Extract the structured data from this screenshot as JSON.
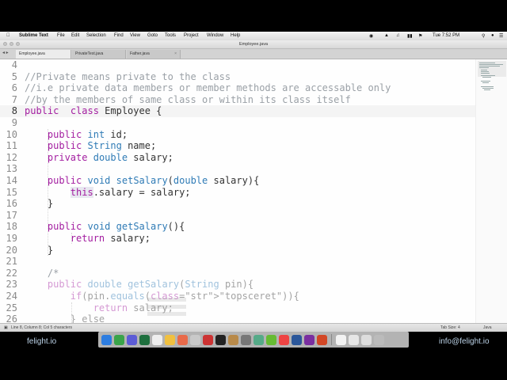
{
  "menubar": {
    "app_name": "Sublime Text",
    "items": [
      "File",
      "Edit",
      "Selection",
      "Find",
      "View",
      "Goto",
      "Tools",
      "Project",
      "Window",
      "Help"
    ],
    "clock": "Tue 7:52 PM"
  },
  "window": {
    "title": "Employee.java"
  },
  "tabs": [
    {
      "label": "Employee.java",
      "active": true
    },
    {
      "label": "PrivateTest.java",
      "active": false
    },
    {
      "label": "Father.java",
      "active": false
    }
  ],
  "editor": {
    "current_line": 8,
    "lines": [
      {
        "n": 4,
        "text": ""
      },
      {
        "n": 5,
        "text": "//Private means private to the class"
      },
      {
        "n": 6,
        "text": "//i.e private data members or member methods are accessable only"
      },
      {
        "n": 7,
        "text": "//by the members of same class or within its class itself"
      },
      {
        "n": 8,
        "text": "public  class Employee {"
      },
      {
        "n": 9,
        "text": ""
      },
      {
        "n": 10,
        "text": "    public int id;"
      },
      {
        "n": 11,
        "text": "    public String name;"
      },
      {
        "n": 12,
        "text": "    private double salary;"
      },
      {
        "n": 13,
        "text": ""
      },
      {
        "n": 14,
        "text": "    public void setSalary(double salary){"
      },
      {
        "n": 15,
        "text": "        this.salary = salary;"
      },
      {
        "n": 16,
        "text": "    }"
      },
      {
        "n": 17,
        "text": ""
      },
      {
        "n": 18,
        "text": "    public void getSalary(){"
      },
      {
        "n": 19,
        "text": "        return salary;"
      },
      {
        "n": 20,
        "text": "    }"
      },
      {
        "n": 21,
        "text": ""
      },
      {
        "n": 22,
        "text": "    /*"
      },
      {
        "n": 23,
        "text": "    public double getSalary(String pin){"
      },
      {
        "n": 24,
        "text": "        if(pin.equals(\"topsceret\")){"
      },
      {
        "n": 25,
        "text": "            return salary;"
      },
      {
        "n": 26,
        "text": "        } else"
      }
    ]
  },
  "statusbar": {
    "position": "Line 8, Column 8; Col 5 characters",
    "tab_size": "Tab Size: 4",
    "syntax": "Java"
  },
  "footer": {
    "left_brand": "felight.io",
    "right_brand": "info@felight.io"
  },
  "colors": {
    "keyword": "#a31da0",
    "type": "#2f7bb6",
    "comment": "#9aa0a6",
    "param": "#e0862c",
    "string": "#2a9c4a"
  }
}
